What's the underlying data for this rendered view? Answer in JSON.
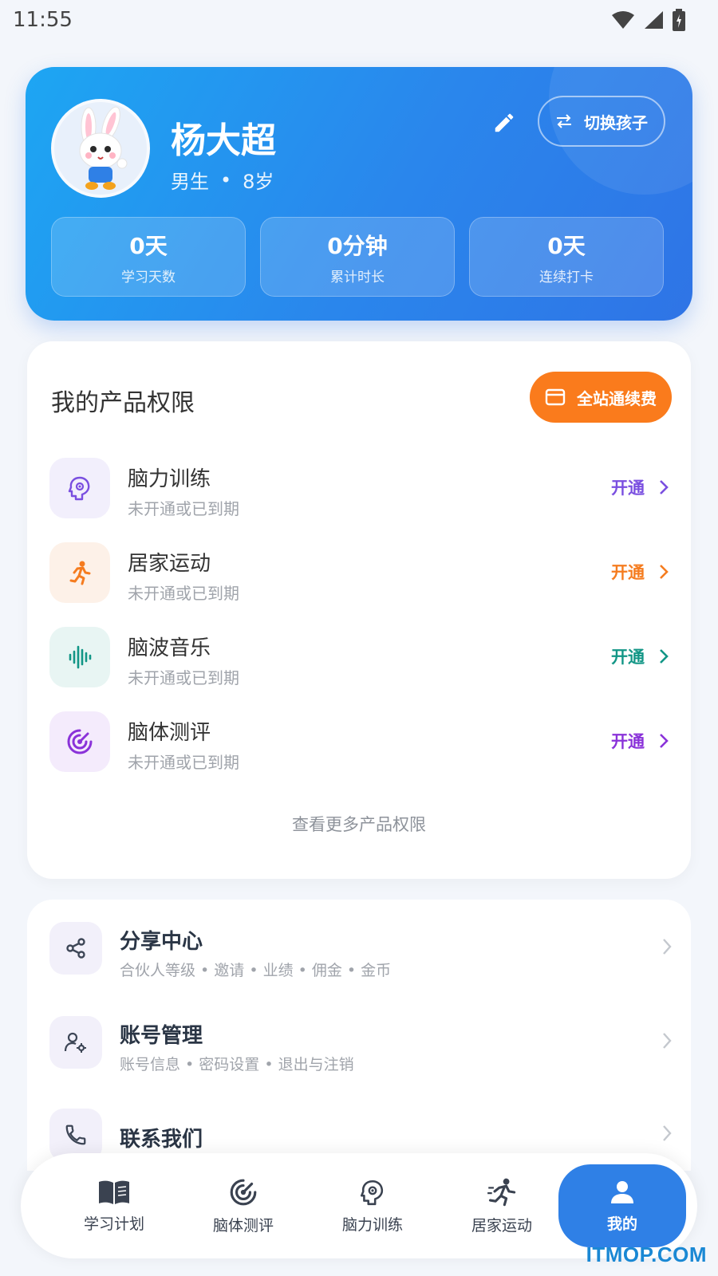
{
  "status_bar": {
    "time": "11:55"
  },
  "profile": {
    "name": "杨大超",
    "gender": "男生",
    "separator": "•",
    "age": "8岁",
    "switch_label": "切换孩子",
    "stats": [
      {
        "value": "0天",
        "label": "学习天数"
      },
      {
        "value": "0分钟",
        "label": "累计时长"
      },
      {
        "value": "0天",
        "label": "连续打卡"
      }
    ]
  },
  "products": {
    "title": "我的产品权限",
    "renew_label": "全站通续费",
    "items": [
      {
        "name": "脑力训练",
        "status": "未开通或已到期",
        "action": "开通",
        "color": "#7a4fe0",
        "bg": "#f2effc",
        "icon": "brain-gear-icon"
      },
      {
        "name": "居家运动",
        "status": "未开通或已到期",
        "action": "开通",
        "color": "#f57c1f",
        "bg": "#fdf1e8",
        "icon": "running-person-icon"
      },
      {
        "name": "脑波音乐",
        "status": "未开通或已到期",
        "action": "开通",
        "color": "#129686",
        "bg": "#e8f5f3",
        "icon": "sound-wave-icon"
      },
      {
        "name": "脑体测评",
        "status": "未开通或已到期",
        "action": "开通",
        "color": "#8a32d9",
        "bg": "#f4ebfc",
        "icon": "radar-target-icon"
      }
    ],
    "more_label": "查看更多产品权限"
  },
  "menu": [
    {
      "title": "分享中心",
      "subtitle": "合伙人等级 • 邀请 • 业绩 • 佣金 • 金币",
      "icon": "share-icon"
    },
    {
      "title": "账号管理",
      "subtitle": "账号信息 • 密码设置 • 退出与注销",
      "icon": "user-settings-icon"
    },
    {
      "title": "联系我们",
      "subtitle": "",
      "icon": "phone-icon"
    }
  ],
  "nav": [
    {
      "label": "学习计划",
      "icon": "book-icon",
      "active": false
    },
    {
      "label": "脑体测评",
      "icon": "radar-target-icon",
      "active": false
    },
    {
      "label": "脑力训练",
      "icon": "brain-gear-icon",
      "active": false
    },
    {
      "label": "居家运动",
      "icon": "running-person-icon",
      "active": false
    },
    {
      "label": "我的",
      "icon": "person-icon",
      "active": true
    }
  ],
  "watermark": "ITMOP.COM",
  "colors": {
    "brand_blue": "#2f80e6",
    "renew_orange": "#fa7b1c"
  }
}
